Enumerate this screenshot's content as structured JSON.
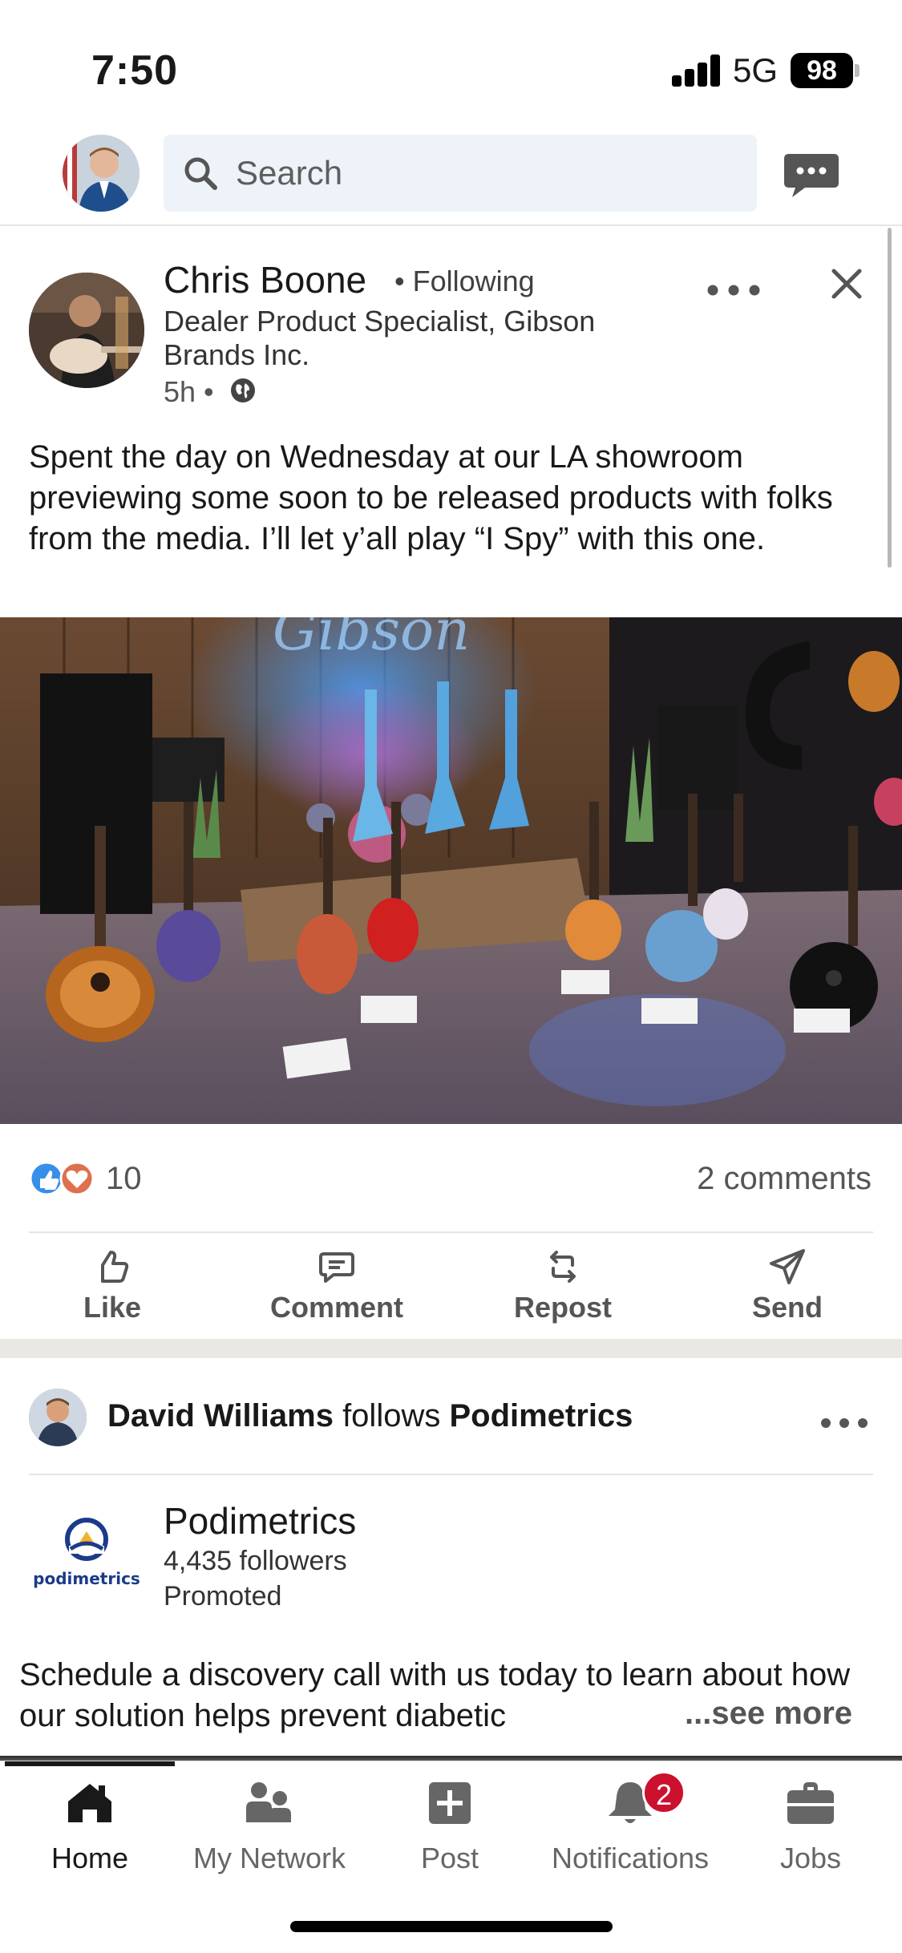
{
  "status_bar": {
    "time": "7:50",
    "network": "5G",
    "battery": "98"
  },
  "topbar": {
    "search_placeholder": "Search"
  },
  "post1": {
    "author_name": "Chris Boone",
    "following": "• Following",
    "headline": "Dealer Product Specialist, Gibson Brands Inc.",
    "time": "5h •",
    "text": "Spent the day on Wednesday at our LA showroom previewing some soon to be released products with folks from the media. I’ll let y’all play “I Spy” with this one.",
    "reactions_count": "10",
    "comments_count": "2 comments",
    "actions": {
      "like": "Like",
      "comment": "Comment",
      "repost": "Repost",
      "send": "Send"
    }
  },
  "post2": {
    "actor": "David Williams",
    "verb": " follows ",
    "target": "Podimetrics",
    "company_name": "Podimetrics",
    "followers": "4,435 followers",
    "promoted": "Promoted",
    "logo_text": "podimetrics",
    "text": "Schedule a discovery call with us today to learn about how our solution helps prevent diabetic",
    "see_more": "...see more"
  },
  "nav": {
    "home": "Home",
    "network": "My Network",
    "post": "Post",
    "notifications": "Notifications",
    "notifications_badge": "2",
    "jobs": "Jobs"
  },
  "colors": {
    "linkedin_blue": "#0a66c2",
    "badge_red": "#cb112d",
    "search_bg": "#edf3f8"
  }
}
